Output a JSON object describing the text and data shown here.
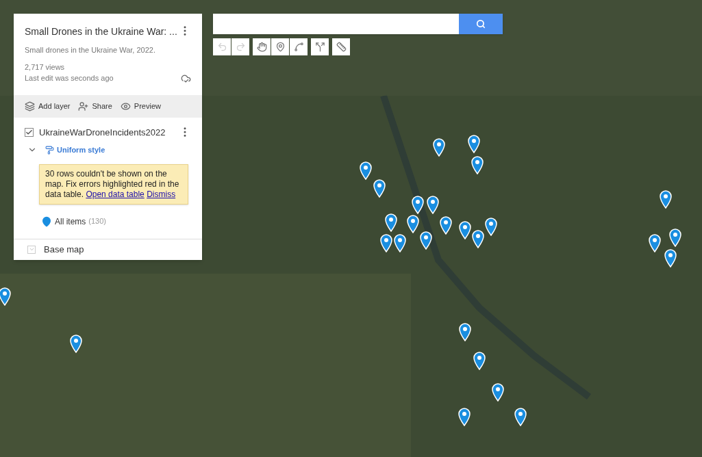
{
  "panel": {
    "title": "Small Drones in the Ukraine War: ...",
    "description": "Small drones in the Ukraine War, 2022.",
    "views": "2,717 views",
    "last_edit": "Last edit was seconds ago",
    "actions": [
      {
        "kind": "layer",
        "label": "Add layer"
      },
      {
        "kind": "share",
        "label": "Share"
      },
      {
        "kind": "preview",
        "label": "Preview"
      }
    ],
    "layer": {
      "name": "UkraineWarDroneIncidents2022",
      "checked": true,
      "expanded": true,
      "style": "Uniform style",
      "warning": {
        "text": "30 rows couldn't be shown on the map. Fix errors highlighted red in the data table.",
        "links": [
          "Open data table",
          "Dismiss"
        ]
      },
      "items_label": "All items",
      "items_count": "(130)"
    },
    "base_map": {
      "label": "Base map",
      "expanded": false
    }
  },
  "tools": [
    {
      "kind": "undo",
      "disabled": true
    },
    {
      "kind": "redo",
      "disabled": true
    },
    {
      "kind": "hand",
      "disabled": false
    },
    {
      "kind": "marker",
      "disabled": false
    },
    {
      "kind": "line",
      "disabled": false
    },
    {
      "kind": "route",
      "disabled": false
    },
    {
      "kind": "ruler",
      "disabled": false
    }
  ]
}
